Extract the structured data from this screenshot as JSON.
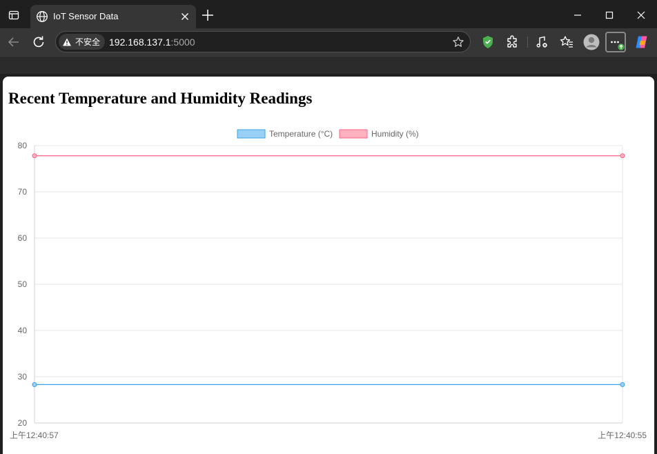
{
  "browser": {
    "tab_title": "IoT Sensor Data",
    "security_label": "不安全",
    "url_host": "192.168.137.1",
    "url_port": ":5000"
  },
  "page": {
    "heading": "Recent Temperature and Humidity Readings"
  },
  "chart_data": {
    "type": "line",
    "title": "",
    "xlabel": "",
    "ylabel": "",
    "categories": [
      "上午12:40:57",
      "上午12:40:55"
    ],
    "ylim": [
      20,
      80
    ],
    "yticks": [
      20,
      30,
      40,
      50,
      60,
      70,
      80
    ],
    "grid": true,
    "legend_position": "top",
    "series": [
      {
        "name": "Temperature (°C)",
        "values": [
          28.3,
          28.3
        ],
        "color": "#36a2eb",
        "fill": "#9ad0f5"
      },
      {
        "name": "Humidity (%)",
        "values": [
          77.8,
          77.8
        ],
        "color": "#ff6384",
        "fill": "#ffb1c1"
      }
    ]
  }
}
